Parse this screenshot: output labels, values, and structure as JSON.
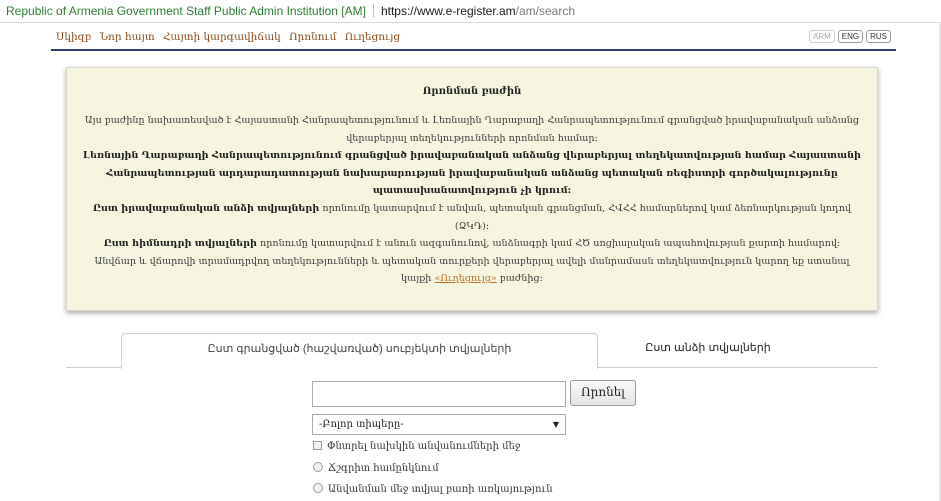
{
  "browser": {
    "cert_owner": "Republic of Armenia Government Staff Public Admin Institution [AM]",
    "url_host": "https://www.e-register.am",
    "url_path": "/am/search"
  },
  "nav": {
    "items": [
      "Սկիզբ",
      "Նոր հայտ",
      "Հայտի կարգավիճակ",
      "Որոնում",
      "Ուղեցույց"
    ],
    "langs": [
      "ARM",
      "ENG",
      "RUS"
    ]
  },
  "info": {
    "title": "Որոնման բաժին",
    "p1": "Այս բաժինը նախատեսված է Հայաստանի Հանրապետությունում և Լեռնային Ղարաբաղի Հանրապետությունում գրանցված իրավաբանական անձանց վերաբերյալ տեղեկությունների որոնման համար:",
    "p2": "Լեռնային Ղարաբաղի Հանրապետությունում գրանցված իրավաբանական անձանց վերաբերյալ տեղեկատվության համար Հայաստանի Հանրապետության արդարադատության նախարարության իրավաբանական անձանց պետական ռեգիստրի գործակալությունը պատասխանատվություն չի կրում:",
    "p3_bold": "Ըստ իրավաբանական անձի տվյալների",
    "p3_rest": " որոնումը կատարվում է անվան, պետական գրանցման, ՀՎՀՀ համարներով կամ ձեռնարկության կոդով (ՁԿԴ):",
    "p4_bold": "Ըստ հիմնադրի տվյալների",
    "p4_rest": " որոնումը կատարվում է անուն ազգանունով, անձնագրի կամ ՀԾ սոցիալական ապահովության քարտի համարով:",
    "p5": "Անվճար և վճարովի տրամադրվող տեղեկությունների և պետական տուրքերի վերաբերյալ ավելի մանրամասն տեղեկատվություն կարող եք ստանալ",
    "p5_pre_link": "կայքի ",
    "link": "«Ուղեցույց»",
    "p5_post_link": " բաժնից:"
  },
  "tabs": {
    "tab1": "Ըստ գրանցված (հաշվառված) սուբյեկտի տվյալների",
    "tab2": "Ըստ անձի տվյալների"
  },
  "search": {
    "input_value": "",
    "button": "Որոնել",
    "select_value": "-Բոլոր տիպերը-",
    "options": {
      "check1": "Փնտրել նախկին անվանումների մեջ",
      "radio1": "Ճշգրիտ համընկնում",
      "radio2": "Անվանման մեջ տվյալ բառի առկայություն"
    }
  }
}
